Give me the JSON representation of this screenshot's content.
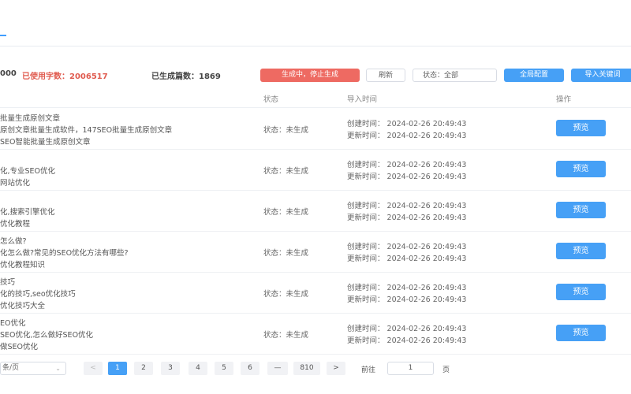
{
  "stats": {
    "limit_tail": "000",
    "used_label": "已使用字数：",
    "used_value": "2006517",
    "generated_label": "已生成篇数：",
    "generated_value": "1869"
  },
  "toolbar": {
    "stop_label": "生成中，停止生成",
    "refresh_label": "刷新",
    "status_filter": "状态：全部",
    "config_label": "全局配置",
    "import_label": "导入关键词"
  },
  "table": {
    "headers": {
      "status": "状态",
      "import_time": "导入时间",
      "actions": "操作"
    },
    "rows": [
      {
        "line1": "批量生成原创文章",
        "line2": "原创文章批量生成软件，147SEO批量生成原创文章",
        "line3": "SEO智能批量生成原创文章",
        "status": "状态：未生成",
        "created": "创建时间：  2024-02-26 20:49:43",
        "updated": "更新时间：  2024-02-26 20:49:43",
        "action": "预览"
      },
      {
        "line1": "",
        "line2": "化,专业SEO优化",
        "line3": "网站优化",
        "status": "状态：未生成",
        "created": "创建时间：  2024-02-26 20:49:43",
        "updated": "更新时间：  2024-02-26 20:49:43",
        "action": "预览"
      },
      {
        "line1": "",
        "line2": "化,搜索引擎优化",
        "line3": "优化教程",
        "status": "状态：未生成",
        "created": "创建时间：  2024-02-26 20:49:43",
        "updated": "更新时间：  2024-02-26 20:49:43",
        "action": "预览"
      },
      {
        "line1": "怎么做?",
        "line2": "化怎么做?常见的SEO优化方法有哪些?",
        "line3": "优化教程知识",
        "status": "状态：未生成",
        "created": "创建时间：  2024-02-26 20:49:43",
        "updated": "更新时间：  2024-02-26 20:49:43",
        "action": "预览"
      },
      {
        "line1": "技巧",
        "line2": "化的技巧,seo优化技巧",
        "line3": "优化技巧大全",
        "status": "状态：未生成",
        "created": "创建时间：  2024-02-26 20:49:43",
        "updated": "更新时间：  2024-02-26 20:49:43",
        "action": "预览"
      },
      {
        "line1": "EO优化",
        "line2": "SEO优化,怎么做好SEO优化",
        "line3": "做SEO优化",
        "status": "状态：未生成",
        "created": "创建时间：  2024-02-26 20:49:43",
        "updated": "更新时间：  2024-02-26 20:49:43",
        "action": "预览"
      }
    ]
  },
  "pagination": {
    "page_size": "条/页",
    "prev": "<",
    "pages": [
      "1",
      "2",
      "3",
      "4",
      "5",
      "6",
      "—",
      "810"
    ],
    "next": ">",
    "current": "1",
    "goto_label": "前往",
    "goto_value": "1",
    "goto_unit": "页"
  },
  "colors": {
    "primary": "#46a0f6",
    "danger": "#ee6a62",
    "used_text": "#e05b4f"
  }
}
